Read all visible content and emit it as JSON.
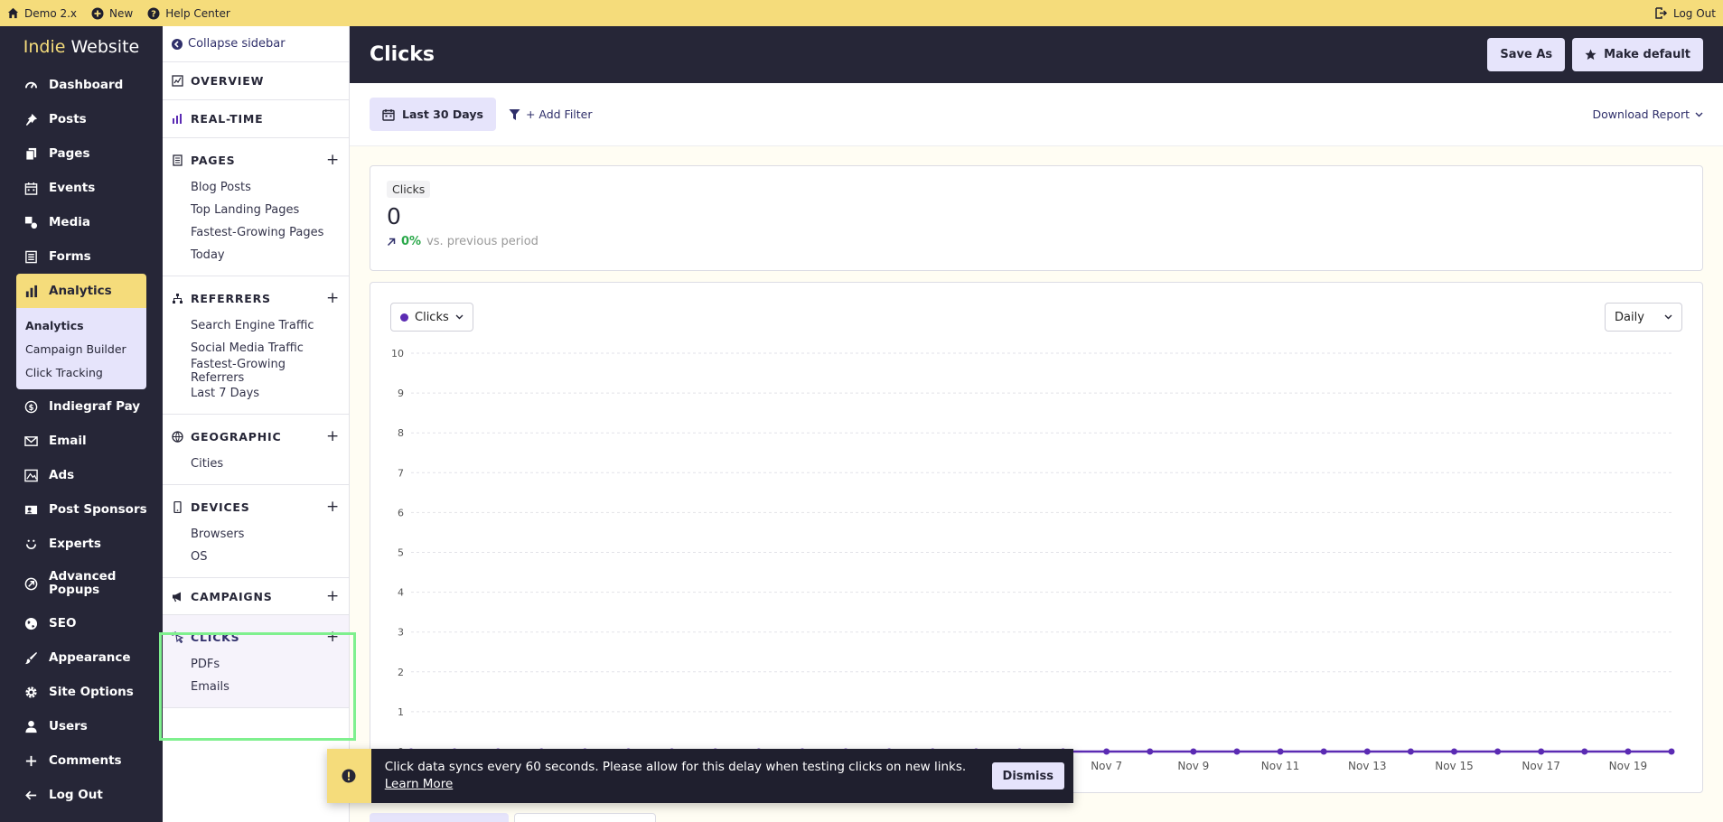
{
  "topbar": {
    "site_label": "Demo 2.x",
    "new_label": "New",
    "help_label": "Help Center",
    "logout_label": "Log Out"
  },
  "brand": {
    "part1": "Indie",
    "part2": "Website"
  },
  "nav": {
    "items": [
      {
        "label": "Dashboard",
        "icon": "speedometer-icon"
      },
      {
        "label": "Posts",
        "icon": "pin-icon"
      },
      {
        "label": "Pages",
        "icon": "pages-icon"
      },
      {
        "label": "Events",
        "icon": "calendar-icon"
      },
      {
        "label": "Media",
        "icon": "media-icon"
      },
      {
        "label": "Forms",
        "icon": "form-icon"
      },
      {
        "label": "Analytics",
        "icon": "bar-chart-icon"
      },
      {
        "label": "Indiegraf Pay",
        "icon": "dollar-icon"
      },
      {
        "label": "Email",
        "icon": "envelope-icon"
      },
      {
        "label": "Ads",
        "icon": "ad-icon"
      },
      {
        "label": "Post Sponsors",
        "icon": "sponsor-icon"
      },
      {
        "label": "Experts",
        "icon": "smile-icon"
      },
      {
        "label": "Advanced Popups",
        "icon": "popup-icon"
      },
      {
        "label": "SEO",
        "icon": "globe-icon"
      },
      {
        "label": "Appearance",
        "icon": "brush-icon"
      },
      {
        "label": "Site Options",
        "icon": "gear-icon"
      },
      {
        "label": "Users",
        "icon": "user-icon"
      },
      {
        "label": "Comments",
        "icon": "plus-icon"
      },
      {
        "label": "Log Out",
        "icon": "arrow-left-icon"
      }
    ],
    "analytics_sub": [
      "Analytics",
      "Campaign Builder",
      "Click Tracking"
    ]
  },
  "sidebar2": {
    "collapse_label": "Collapse sidebar",
    "sections": [
      {
        "title": "OVERVIEW",
        "links": []
      },
      {
        "title": "REAL-TIME",
        "links": []
      },
      {
        "title": "PAGES",
        "links": [
          "Blog Posts",
          "Top Landing Pages",
          "Fastest-Growing Pages",
          "Today"
        ]
      },
      {
        "title": "REFERRERS",
        "links": [
          "Search Engine Traffic",
          "Social Media Traffic",
          "Fastest-Growing Referrers",
          "Last 7 Days"
        ]
      },
      {
        "title": "GEOGRAPHIC",
        "links": [
          "Cities"
        ]
      },
      {
        "title": "DEVICES",
        "links": [
          "Browsers",
          "OS"
        ]
      },
      {
        "title": "CAMPAIGNS",
        "links": []
      },
      {
        "title": "CLICKS",
        "links": [
          "PDFs",
          "Emails"
        ]
      }
    ]
  },
  "header": {
    "title": "Clicks",
    "save_as": "Save As",
    "make_default": "Make default"
  },
  "filters": {
    "date_range": "Last 30 Days",
    "add_filter": "+ Add Filter",
    "download": "Download Report"
  },
  "stat": {
    "label": "Clicks",
    "value": "0",
    "change_pct": "0%",
    "change_suffix": "vs. previous period"
  },
  "chart_controls": {
    "series_label": "Clicks",
    "period": "Daily"
  },
  "chart_data": {
    "type": "line",
    "ylim": [
      0,
      10
    ],
    "y_ticks": [
      0,
      1,
      2,
      3,
      4,
      5,
      6,
      7,
      8,
      9,
      10
    ],
    "x_labels": [
      "Nov 7",
      "Nov 9",
      "Nov 11",
      "Nov 13",
      "Nov 15",
      "Nov 17",
      "Nov 19"
    ],
    "series": [
      {
        "name": "Clicks",
        "color": "#5b2bb3",
        "values": [
          0,
          0,
          0,
          0,
          0,
          0,
          0,
          0,
          0,
          0,
          0,
          0,
          0,
          0,
          0,
          0,
          0,
          0,
          0,
          0,
          0,
          0,
          0,
          0,
          0,
          0,
          0,
          0,
          0,
          0
        ]
      }
    ],
    "grid": true
  },
  "toast": {
    "message": "Click data syncs every 60 seconds. Please allow for this delay when testing clicks on new links.",
    "link": "Learn More",
    "dismiss": "Dismiss"
  },
  "colors": {
    "accent_yellow": "#f5dc7b",
    "dark": "#262637",
    "lavender": "#e6e4fb",
    "series_purple": "#5b2bb3",
    "highlight_green": "#7ff08e"
  }
}
